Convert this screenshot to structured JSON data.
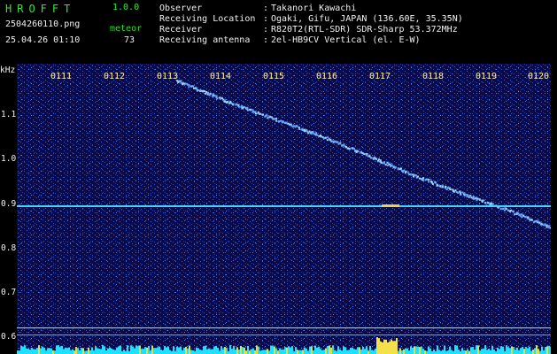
{
  "header": {
    "app_name": "HROFFT",
    "app_version": "1.0.0",
    "file_name": "2504260110.png",
    "datetime": "25.04.26 01:10",
    "count_label": "meteor",
    "count_value": "73",
    "fields": [
      {
        "label": "Observer",
        "sep": ":",
        "value": "Takanori Kawachi"
      },
      {
        "label": "Receiving Location",
        "sep": ":",
        "value": "Ogaki, Gifu, JAPAN (136.60E, 35.35N)"
      },
      {
        "label": "Receiver",
        "sep": ":",
        "value": "R820T2(RTL-SDR) SDR-Sharp 53.372MHz"
      },
      {
        "label": "Receiving antenna",
        "sep": ":",
        "value": "2el-HB9CV Vertical (el. E-W)"
      }
    ]
  },
  "spectrogram": {
    "unit_label": "kHz",
    "y_ticks": [
      "1.1",
      "1.0",
      "0.9",
      "0.8",
      "0.7",
      "0.6"
    ],
    "time_labels": [
      "0111",
      "0112",
      "0113",
      "0114",
      "0115",
      "0116",
      "0117",
      "0118",
      "0119",
      "0120"
    ],
    "colors": {
      "background": "#0a0a4a",
      "trace": "#9fd8ff",
      "carrier": "#3ed6ff",
      "noise": "#1fe0ff"
    }
  }
}
